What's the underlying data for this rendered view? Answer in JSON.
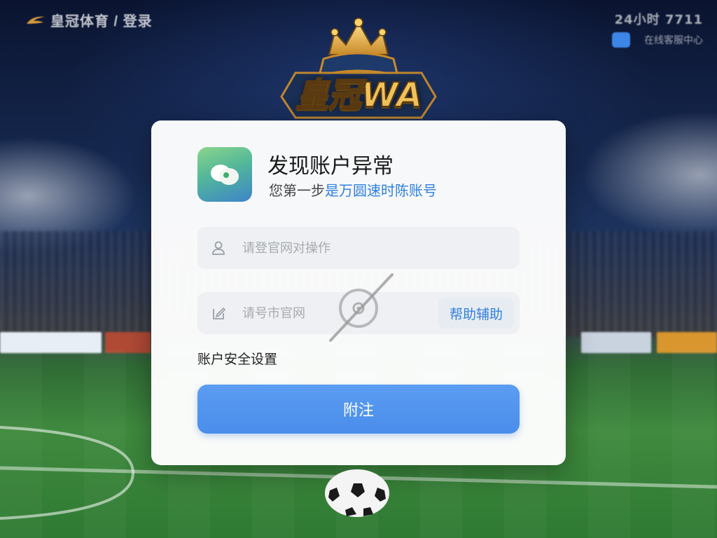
{
  "top_bar": {
    "left_title": "皇冠体育 / 登录",
    "right_text_1": "24小时 7711",
    "right_text_2": "在线客服中心",
    "accent": "#3c86e8"
  },
  "logo": {
    "crown_icon": "crown-icon",
    "text": "皇冠WA"
  },
  "card": {
    "title": "发现账户异常",
    "subtitle_prefix": "您第一步",
    "subtitle_highlight": "是万圆速时陈账号",
    "username": {
      "icon": "user-icon",
      "placeholder": "请登官网对操作",
      "value": ""
    },
    "password": {
      "icon": "edit-icon",
      "placeholder": "请号市官网",
      "value": "",
      "help_label": "帮助辅助"
    },
    "security_link": "账户安全设置",
    "submit_label": "附注",
    "accent": "#4a8deb"
  }
}
